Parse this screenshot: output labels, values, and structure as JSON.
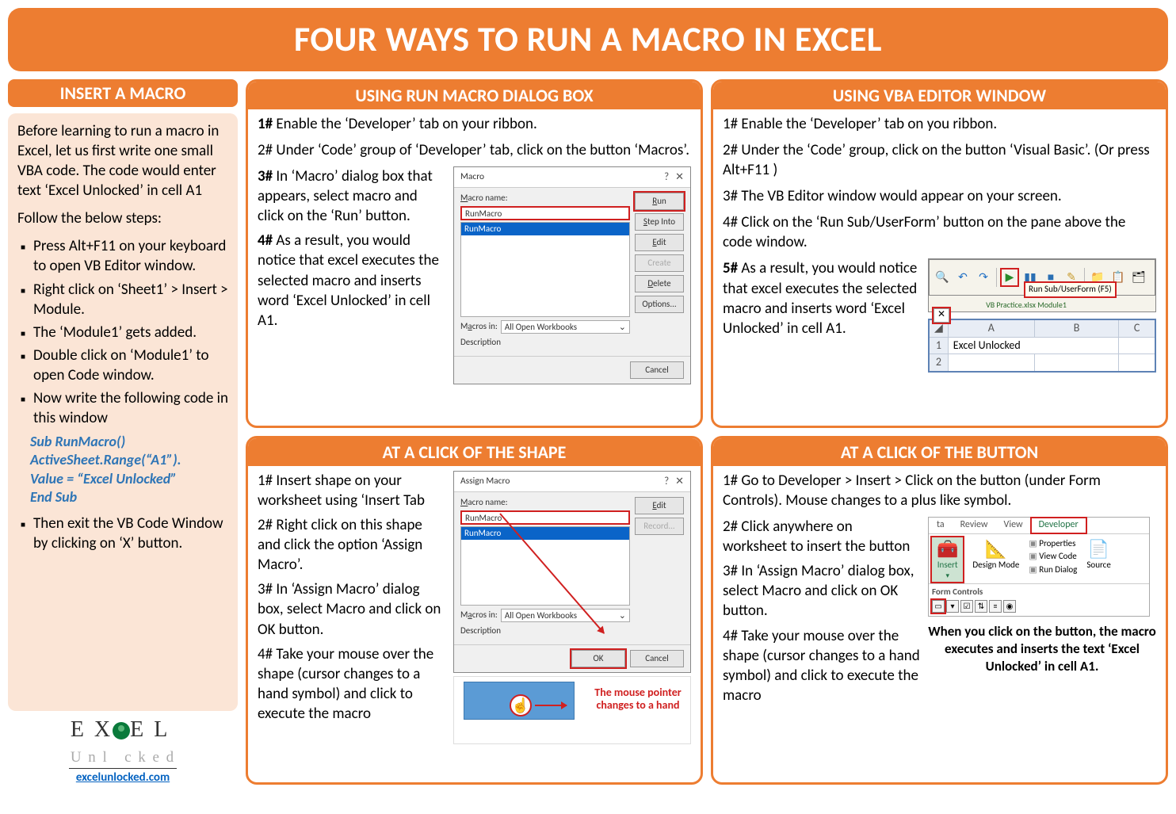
{
  "page_title": "FOUR WAYS TO RUN A MACRO IN EXCEL",
  "left": {
    "header": "INSERT A MACRO",
    "intro1": "Before learning to run a macro in Excel, let us first write one small VBA code. The code would enter text ‘Excel Unlocked’ in cell A1",
    "intro2": "Follow the below steps:",
    "bullets": [
      "Press Alt+F11 on your keyboard to open VB Editor window.",
      "Right click on ‘Sheet1’ > Insert > Module.",
      "The ‘Module1’ gets added.",
      "Double click on ‘Module1’ to open Code window.",
      "Now write the following code in this window"
    ],
    "code": {
      "l1": "Sub RunMacro()",
      "l2": "ActiveSheet.Range(“A1”).",
      "l3": "Value = “Excel Unlocked”",
      "l4": "End Sub"
    },
    "bullet_after": "Then exit the VB Code Window by clicking on ‘X’ button.",
    "logo_main": "E X  E L",
    "logo_sub": "Unl  cked",
    "site": "excelunlocked.com"
  },
  "center_top": {
    "header": "USING RUN MACRO DIALOG BOX",
    "steps": {
      "s1_b": "1#",
      "s1": "Enable the ‘Developer’ tab on your ribbon.",
      "s2": "2# Under ‘Code’ group of ‘Developer’ tab, click on the button ‘Macros’.",
      "s3_b": "3#",
      "s3": "In ‘Macro’ dialog box that appears, select macro and click on the ‘Run’ button.",
      "s4_b": "4#",
      "s4": "As a result, you would notice that excel executes the selected macro and inserts word ‘Excel Unlocked’ in cell A1."
    },
    "dialog": {
      "title": "Macro",
      "name_label": "Macro name:",
      "name_value": "RunMacro",
      "selected": "RunMacro",
      "macros_in_label": "Macros in:",
      "macros_in_value": "All Open Workbooks",
      "desc_label": "Description",
      "btn_run": "Run",
      "btn_step": "Step Into",
      "btn_edit": "Edit",
      "btn_create": "Create",
      "btn_delete": "Delete",
      "btn_options": "Options...",
      "btn_cancel": "Cancel"
    }
  },
  "center_bottom": {
    "header": "AT A CLICK OF THE SHAPE",
    "steps": {
      "s1": "1# Insert shape on your worksheet using ‘Insert Tab",
      "s2": "2# Right click on this shape and click the option ‘Assign Macro’.",
      "s3": "3# In ‘Assign Macro’ dialog box, select Macro and click on OK button.",
      "s4": "4# Take your mouse over the shape (cursor changes to a hand symbol) and click to execute the macro"
    },
    "dialog": {
      "title": "Assign Macro",
      "name_label": "Macro name:",
      "name_value": "RunMacro",
      "selected": "RunMacro",
      "macros_in_label": "Macros in:",
      "macros_in_value": "All Open Workbooks",
      "desc_label": "Description",
      "btn_edit": "Edit",
      "btn_record": "Record...",
      "btn_ok": "OK",
      "btn_cancel": "Cancel"
    },
    "hand_caption": "The mouse pointer changes to a hand"
  },
  "right_top": {
    "header": "USING VBA EDITOR WINDOW",
    "steps": {
      "s1": "1# Enable the ‘Developer’ tab on you ribbon.",
      "s2": "2# Under the ‘Code’ group, click on the button ‘Visual Basic’. (Or press Alt+F11 )",
      "s3": "3# The VB Editor window would appear on your screen.",
      "s4": "4# Click on the ‘Run Sub/UserForm’ button on the pane above the code window.",
      "s5_b": "5#",
      "s5": "As a result, you would notice that excel executes the selected macro and inserts word ‘Excel Unlocked’ in cell A1."
    },
    "tooltip": "Run Sub/UserForm (F5)",
    "tooltip2": "VB Practice.xlsx   Module1",
    "grid": {
      "colA": "A",
      "colB": "B",
      "colC": "C",
      "r1": "1",
      "r2": "2",
      "a1": "Excel Unlocked"
    }
  },
  "right_bottom": {
    "header": "AT A CLICK OF THE BUTTON",
    "steps": {
      "s1": "1# Go to Developer > Insert > Click on the button (under Form Controls). Mouse changes to a plus like symbol.",
      "s2": "2# Click anywhere on worksheet to insert the button",
      "s3": "3# In ‘Assign Macro’ dialog box, select Macro and click on OK button.",
      "s4": "4# Take your mouse over the shape (cursor changes to a hand symbol) and click to execute the macro"
    },
    "ribbon": {
      "tab_data": "ta",
      "tab_review": "Review",
      "tab_view": "View",
      "tab_dev": "Developer",
      "insert": "Insert",
      "design": "Design Mode",
      "prop": "Properties",
      "code": "View Code",
      "rundlg": "Run Dialog",
      "source": "Source",
      "group": "Form Controls"
    },
    "caption": "When you click on the button, the macro executes and inserts the text ‘Excel Unlocked’ in cell A1."
  }
}
